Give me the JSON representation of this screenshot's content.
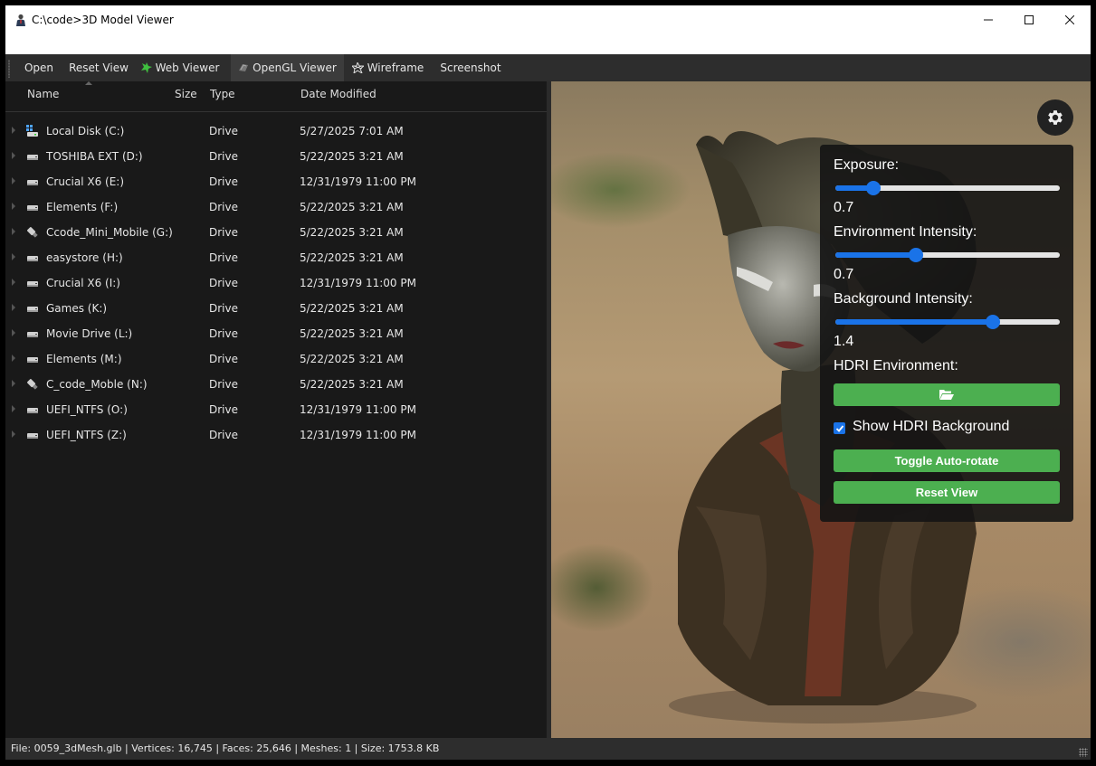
{
  "window": {
    "title": "C:\\code>3D Model Viewer"
  },
  "toolbar": {
    "open": "Open",
    "reset_view": "Reset View",
    "web_viewer": "Web Viewer",
    "opengl_viewer": "OpenGL Viewer",
    "wireframe": "Wireframe",
    "screenshot": "Screenshot"
  },
  "columns": {
    "name": "Name",
    "size": "Size",
    "type": "Type",
    "date": "Date Modified"
  },
  "drives": [
    {
      "name": "Local Disk (C:)",
      "type": "Drive",
      "date": "5/27/2025 7:01 AM",
      "icon": "system-drive-icon"
    },
    {
      "name": "TOSHIBA EXT (D:)",
      "type": "Drive",
      "date": "5/22/2025 3:21 AM",
      "icon": "drive-icon"
    },
    {
      "name": "Crucial X6 (E:)",
      "type": "Drive",
      "date": "12/31/1979 11:00 PM",
      "icon": "drive-icon"
    },
    {
      "name": "Elements (F:)",
      "type": "Drive",
      "date": "5/22/2025 3:21 AM",
      "icon": "drive-icon"
    },
    {
      "name": "Ccode_Mini_Mobile (G:)",
      "type": "Drive",
      "date": "5/22/2025 3:21 AM",
      "icon": "usb-drive-icon"
    },
    {
      "name": "easystore (H:)",
      "type": "Drive",
      "date": "5/22/2025 3:21 AM",
      "icon": "drive-icon"
    },
    {
      "name": "Crucial X6 (I:)",
      "type": "Drive",
      "date": "12/31/1979 11:00 PM",
      "icon": "drive-icon"
    },
    {
      "name": "Games (K:)",
      "type": "Drive",
      "date": "5/22/2025 3:21 AM",
      "icon": "drive-icon"
    },
    {
      "name": "Movie Drive (L:)",
      "type": "Drive",
      "date": "5/22/2025 3:21 AM",
      "icon": "drive-icon"
    },
    {
      "name": "Elements (M:)",
      "type": "Drive",
      "date": "5/22/2025 3:21 AM",
      "icon": "drive-icon"
    },
    {
      "name": "C_code_Moble (N:)",
      "type": "Drive",
      "date": "5/22/2025 3:21 AM",
      "icon": "usb-drive-icon"
    },
    {
      "name": "UEFI_NTFS (O:)",
      "type": "Drive",
      "date": "12/31/1979 11:00 PM",
      "icon": "drive-icon"
    },
    {
      "name": "UEFI_NTFS (Z:)",
      "type": "Drive",
      "date": "12/31/1979 11:00 PM",
      "icon": "drive-icon"
    }
  ],
  "panel": {
    "exposure_label": "Exposure:",
    "exposure_value": "0.7",
    "exposure_fraction": 0.17,
    "env_label": "Environment Intensity:",
    "env_value": "0.7",
    "env_fraction": 0.36,
    "bg_label": "Background Intensity:",
    "bg_value": "1.4",
    "bg_fraction": 0.7,
    "hdri_label": "HDRI Environment:",
    "show_hdri_label": "Show HDRI Background",
    "show_hdri_checked": true,
    "toggle_rotate": "Toggle Auto-rotate",
    "reset_view": "Reset View"
  },
  "colors": {
    "accent_blue": "#1a73e8",
    "button_green": "#4caf50"
  },
  "status": "File: 0059_3dMesh.glb | Vertices: 16,745 | Faces: 25,646 | Meshes: 1 | Size: 1753.8 KB"
}
